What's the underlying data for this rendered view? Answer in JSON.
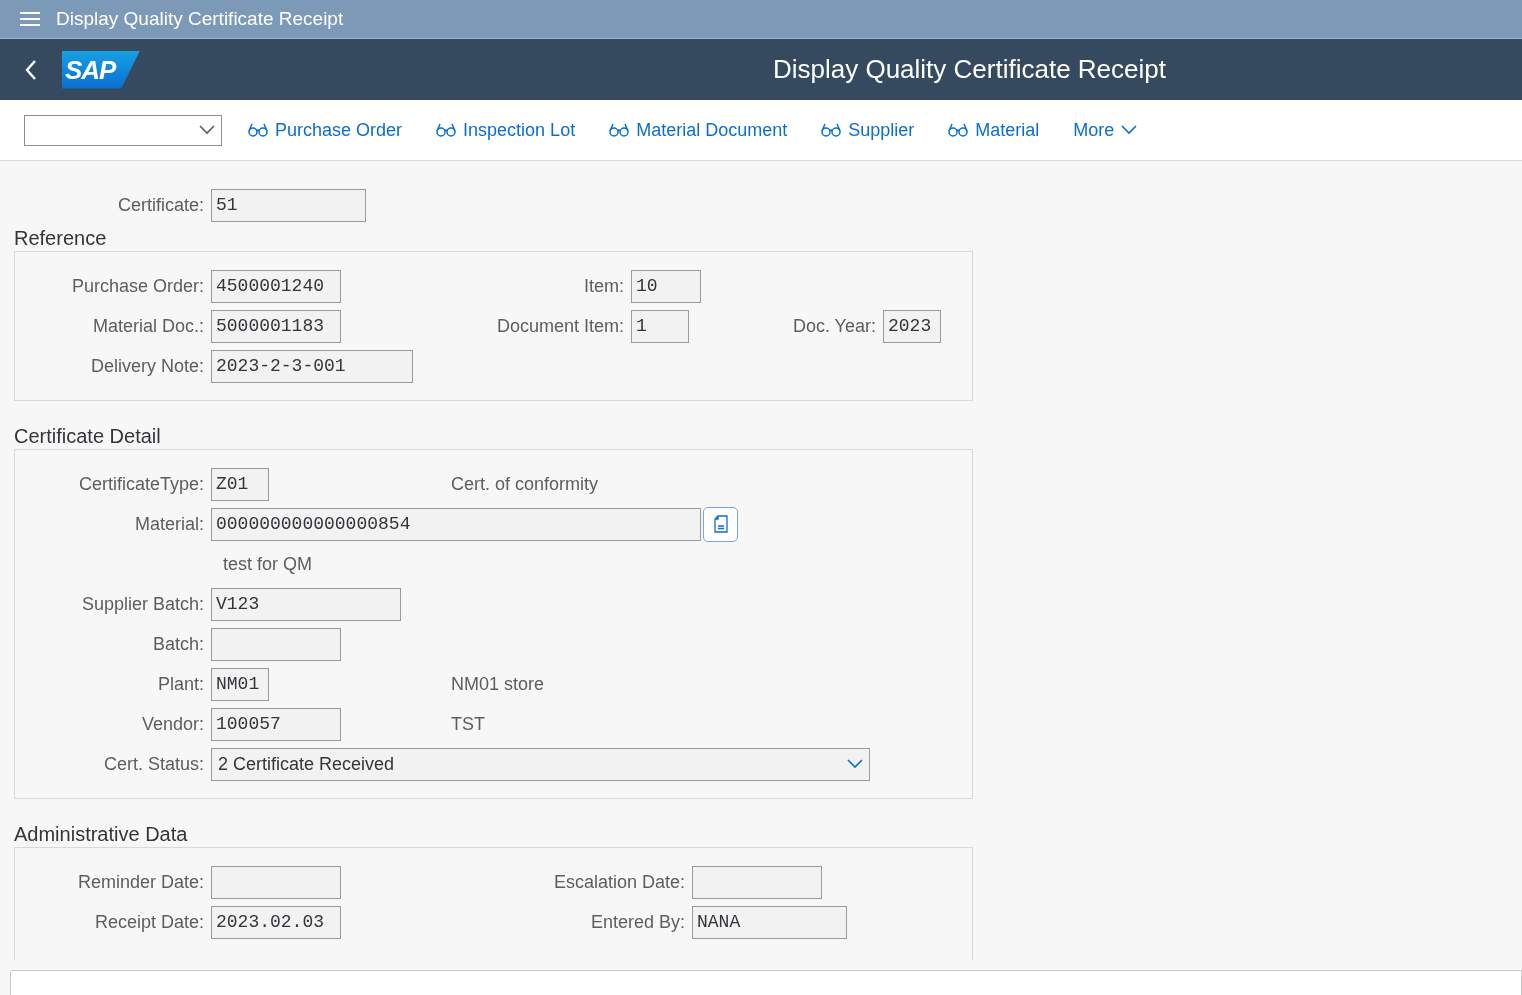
{
  "shell": {
    "title": "Display Quality Certificate Receipt"
  },
  "header": {
    "title": "Display Quality Certificate Receipt",
    "logo": "SAP"
  },
  "toolbar": {
    "actions": [
      {
        "kind": "link",
        "label": "Purchase Order"
      },
      {
        "kind": "link",
        "label": "Inspection Lot"
      },
      {
        "kind": "link",
        "label": "Material Document"
      },
      {
        "kind": "link",
        "label": "Supplier"
      },
      {
        "kind": "link",
        "label": "Material"
      },
      {
        "kind": "menu",
        "label": "More"
      }
    ]
  },
  "certificate": {
    "label": "Certificate:",
    "value": "51"
  },
  "sections": [
    {
      "title": "Reference",
      "rows": [
        [
          {
            "kind": "field",
            "label": "Purchase Order:",
            "value": "4500001240"
          },
          {
            "kind": "field",
            "label": "Item:",
            "value": "10"
          }
        ],
        [
          {
            "kind": "field",
            "label": "Material Doc.:",
            "value": "5000001183"
          },
          {
            "kind": "field",
            "label": "Document Item:",
            "value": "1"
          },
          {
            "kind": "field",
            "label": "Doc. Year:",
            "value": "2023"
          }
        ],
        [
          {
            "kind": "field",
            "label": "Delivery Note:",
            "value": "2023-2-3-001"
          }
        ]
      ]
    },
    {
      "title": "Certificate Detail",
      "rows": [
        [
          {
            "kind": "field",
            "label": "CertificateType:",
            "value": "Z01"
          },
          {
            "kind": "text",
            "text": "Cert. of conformity"
          }
        ],
        [
          {
            "kind": "lookup",
            "label": "Material:",
            "value": "000000000000000854"
          }
        ],
        [
          {
            "kind": "text",
            "text": "test for QM"
          }
        ],
        [
          {
            "kind": "field",
            "label": "Supplier Batch:",
            "value": "V123"
          }
        ],
        [
          {
            "kind": "field",
            "label": "Batch:"
          }
        ],
        [
          {
            "kind": "field",
            "label": "Plant:",
            "value": "NM01"
          },
          {
            "kind": "text",
            "text": "NM01 store"
          }
        ],
        [
          {
            "kind": "field",
            "label": "Vendor:",
            "value": "100057"
          },
          {
            "kind": "text",
            "text": "TST"
          }
        ],
        [
          {
            "kind": "select",
            "label": "Cert. Status:",
            "value": "2 Certificate Received"
          }
        ]
      ]
    },
    {
      "title": "Administrative Data",
      "rows": [
        [
          {
            "kind": "field",
            "label": "Reminder Date:"
          },
          {
            "kind": "field",
            "label": "Escalation Date:"
          }
        ],
        [
          {
            "kind": "field",
            "label": "Receipt Date:",
            "value": "2023.02.03"
          },
          {
            "kind": "field",
            "label": "Entered By:",
            "value": "NANA"
          }
        ]
      ]
    }
  ]
}
